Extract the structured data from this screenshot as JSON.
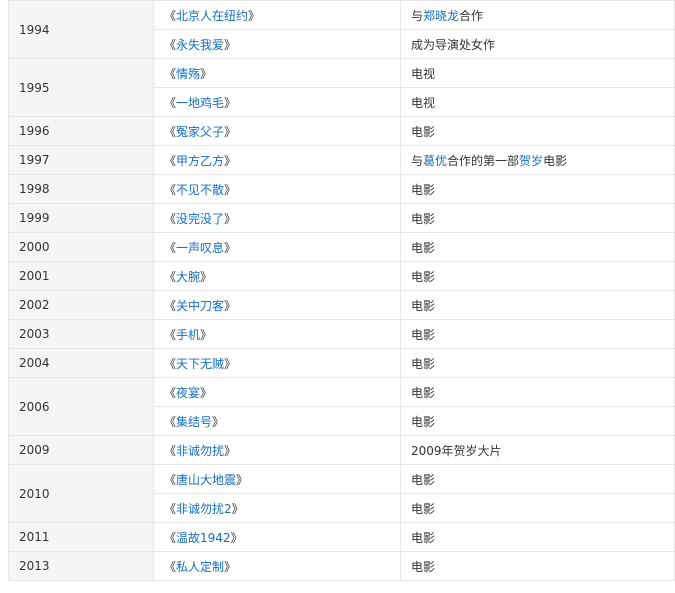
{
  "rows": [
    {
      "year": "1994",
      "rowspan": 2,
      "title": "北京人在纽约",
      "note": [
        {
          "t": "与"
        },
        {
          "t": "郑晓龙",
          "link": true
        },
        {
          "t": "合作"
        }
      ]
    },
    {
      "title": "永失我爱",
      "note": [
        {
          "t": "成为导演处女作"
        }
      ]
    },
    {
      "year": "1995",
      "rowspan": 2,
      "title": "情殇",
      "note": [
        {
          "t": "电视"
        }
      ]
    },
    {
      "title": "一地鸡毛",
      "note": [
        {
          "t": "电视"
        }
      ]
    },
    {
      "year": "1996",
      "rowspan": 1,
      "title": "冤家父子",
      "note": [
        {
          "t": "电影"
        }
      ]
    },
    {
      "year": "1997",
      "rowspan": 1,
      "title": "甲方乙方",
      "note": [
        {
          "t": "与"
        },
        {
          "t": "葛优",
          "link": true
        },
        {
          "t": "合作的第一部"
        },
        {
          "t": "贺岁",
          "link": true
        },
        {
          "t": "电影"
        }
      ]
    },
    {
      "year": "1998",
      "rowspan": 1,
      "title": "不见不散",
      "note": [
        {
          "t": "电影"
        }
      ]
    },
    {
      "year": "1999",
      "rowspan": 1,
      "title": "没完没了",
      "note": [
        {
          "t": "电影"
        }
      ]
    },
    {
      "year": "2000",
      "rowspan": 1,
      "title": "一声叹息",
      "note": [
        {
          "t": "电影"
        }
      ]
    },
    {
      "year": "2001",
      "rowspan": 1,
      "title": "大腕",
      "note": [
        {
          "t": "电影"
        }
      ]
    },
    {
      "year": "2002",
      "rowspan": 1,
      "title": "关中刀客",
      "note": [
        {
          "t": "电影"
        }
      ]
    },
    {
      "year": "2003",
      "rowspan": 1,
      "title": "手机",
      "note": [
        {
          "t": "电影"
        }
      ]
    },
    {
      "year": "2004",
      "rowspan": 1,
      "title": "天下无贼",
      "note": [
        {
          "t": "电影"
        }
      ]
    },
    {
      "year": "2006",
      "rowspan": 2,
      "title": "夜宴",
      "note": [
        {
          "t": "电影"
        }
      ]
    },
    {
      "title": "集结号",
      "note": [
        {
          "t": "电影"
        }
      ]
    },
    {
      "year": "2009",
      "rowspan": 1,
      "title": "非诚勿扰",
      "note": [
        {
          "t": "2009年贺岁大片"
        }
      ]
    },
    {
      "year": "2010",
      "rowspan": 2,
      "title": "唐山大地震",
      "note": [
        {
          "t": "电影"
        }
      ]
    },
    {
      "title": "非诚勿扰2",
      "note": [
        {
          "t": "电影"
        }
      ]
    },
    {
      "year": "2011",
      "rowspan": 1,
      "title": "温故1942",
      "note": [
        {
          "t": "电影"
        }
      ]
    },
    {
      "year": "2013",
      "rowspan": 1,
      "title": "私人定制",
      "note": [
        {
          "t": "电影"
        }
      ]
    }
  ],
  "quote_open": "《",
  "quote_close": "》",
  "colors": {
    "link": "#136ec2",
    "text": "#333333",
    "border": "#e6e6e6",
    "year_bg": "#f5f5f5"
  }
}
